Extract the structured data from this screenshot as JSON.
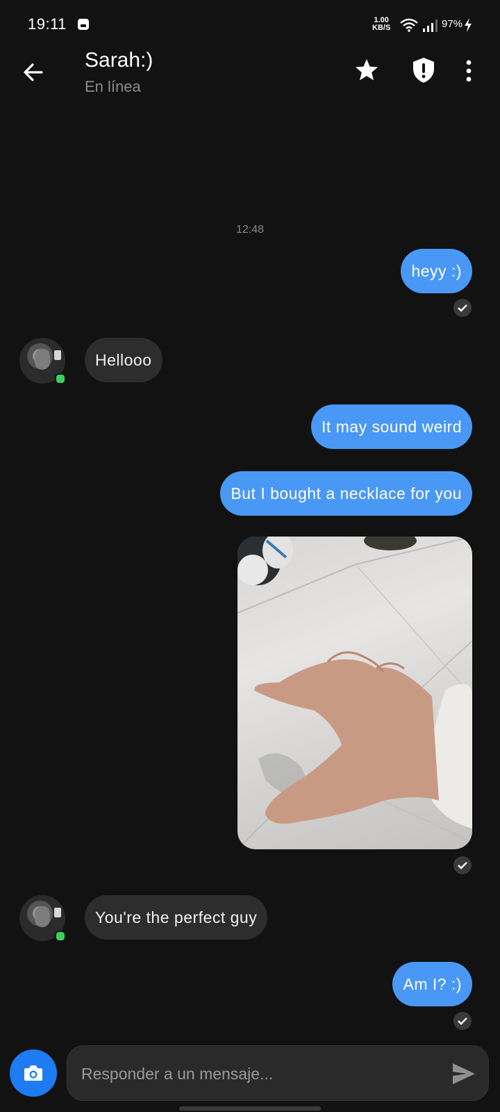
{
  "status_bar": {
    "time": "19:11",
    "net_speed_value": "1.00",
    "net_speed_unit": "KB/S",
    "battery": "97%",
    "icons": [
      "app-notification-icon",
      "wifi-icon",
      "signal-icon",
      "charging-bolt-icon"
    ]
  },
  "header": {
    "contact_name": "Sarah:)",
    "contact_status": "En línea",
    "icons": [
      "back-arrow-icon",
      "star-icon",
      "shield-alert-icon",
      "more-vert-icon"
    ]
  },
  "conversation": {
    "timestamp": "12:48",
    "messages": [
      {
        "direction": "out",
        "type": "text",
        "text": "heyy :)",
        "read": true
      },
      {
        "direction": "in",
        "type": "text",
        "text": "Hellooo"
      },
      {
        "direction": "out",
        "type": "text",
        "text": "It may sound weird"
      },
      {
        "direction": "out",
        "type": "text",
        "text": "But I bought a necklace for you"
      },
      {
        "direction": "out",
        "type": "image",
        "read": true
      },
      {
        "direction": "in",
        "type": "text",
        "text": "You're the perfect guy"
      },
      {
        "direction": "out",
        "type": "text",
        "text": "Am I? :)",
        "read": true
      }
    ]
  },
  "composer": {
    "placeholder": "Responder a un mensaje...",
    "value": "",
    "icons": [
      "camera-icon",
      "send-icon"
    ]
  },
  "colors": {
    "background": "#121212",
    "outgoing_bubble": "#4a98f6",
    "incoming_bubble": "#2d2d2d",
    "camera_button": "#1e7cf2",
    "online_dot": "#3ccf5a"
  }
}
